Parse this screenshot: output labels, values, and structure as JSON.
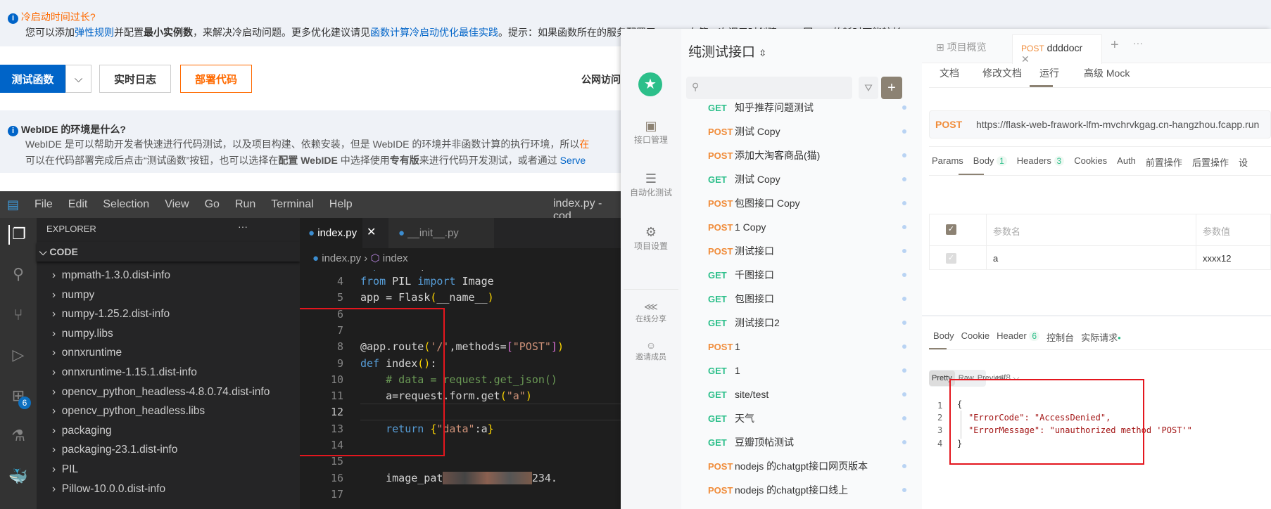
{
  "banner1": {
    "title": "冷启动时间过长?",
    "text_a": "您可以添加",
    "link_a": "弹性规则",
    "text_b": "并配置",
    "bold_b": "最小实例数",
    "text_c": "，来解决冷启动问题。更多优化建议请见",
    "link_c": "函数计算冷启动优化最佳实践",
    "text_d": "。提示：如果函数所在的服务配置了 VPC，在第一次调用时创建 VPC 网……的耗时可能较长"
  },
  "toolbar": {
    "test_label": "测试函数",
    "logs_label": "实时日志",
    "deploy_label": "部署代码",
    "public_label": "公网访问"
  },
  "banner2": {
    "title": "WebIDE 的环境是什么?",
    "line1": "WebIDE 是可以帮助开发者快速进行代码测试，以及项目构建、依赖安装，但是 WebIDE 的环境并非函数计算的执行环境，所以",
    "line1_tail": "在",
    "line2_a": "可以在代码部署完成后点击“测试函数”按钮，也可以选择在",
    "line2_bold1": "配置 WebIDE",
    "line2_b": " 中选择使用",
    "line2_bold2": "专有版",
    "line2_c": "来进行代码开发测试，或者通过 ",
    "line2_link": "Serve"
  },
  "vscode": {
    "menu": [
      "File",
      "Edit",
      "Selection",
      "View",
      "Go",
      "Run",
      "Terminal",
      "Help"
    ],
    "window_title": "index.py - cod",
    "explorer_title": "EXPLORER",
    "folder": "CODE",
    "ext_badge": "6",
    "tree": [
      "mpmath-1.3.0.dist-info",
      "numpy",
      "numpy-1.25.2.dist-info",
      "numpy.libs",
      "onnxruntime",
      "onnxruntime-1.15.1.dist-info",
      "opencv_python_headless-4.8.0.74.dist-info",
      "opencv_python_headless.libs",
      "packaging",
      "packaging-23.1.dist-info",
      "PIL",
      "Pillow-10.0.0.dist-info"
    ],
    "tabs": [
      {
        "label": "index.py",
        "active": true
      },
      {
        "label": "__init__.py",
        "active": false
      }
    ],
    "breadcrumb": [
      "index.py",
      "index"
    ]
  },
  "apifox": {
    "project": "纯测试接口",
    "side": [
      "接口管理",
      "自动化测试",
      "项目设置",
      "在线分享",
      "邀请成员"
    ],
    "items": [
      {
        "m": "GET",
        "n": "知乎推荐问题测试"
      },
      {
        "m": "POST",
        "n": "测试 Copy"
      },
      {
        "m": "POST",
        "n": "添加大淘客商品(猫)"
      },
      {
        "m": "GET",
        "n": "测试 Copy"
      },
      {
        "m": "POST",
        "n": "包图接口 Copy"
      },
      {
        "m": "POST",
        "n": "1 Copy"
      },
      {
        "m": "POST",
        "n": "测试接口"
      },
      {
        "m": "GET",
        "n": "千图接口"
      },
      {
        "m": "GET",
        "n": "包图接口"
      },
      {
        "m": "GET",
        "n": "测试接口2"
      },
      {
        "m": "POST",
        "n": "1"
      },
      {
        "m": "GET",
        "n": "1"
      },
      {
        "m": "GET",
        "n": "site/test"
      },
      {
        "m": "GET",
        "n": "天气"
      },
      {
        "m": "GET",
        "n": "豆瓣顶帖测试"
      },
      {
        "m": "POST",
        "n": "nodejs 的chatgpt接口网页版本"
      },
      {
        "m": "POST",
        "n": "nodejs 的chatgpt接口线上"
      }
    ],
    "top_tabs": {
      "overview": "项目概览",
      "req_method": "POST",
      "req_name": "ddddocr"
    },
    "sub_tabs": [
      "文档",
      "修改文档",
      "运行",
      "高级 Mock"
    ],
    "method": "POST",
    "url": "https://flask-web-frawork-lfm-mvchrvkgag.cn-hangzhou.fcapp.run",
    "param_tabs": [
      {
        "l": "Params"
      },
      {
        "l": "Body",
        "b": "1"
      },
      {
        "l": "Headers",
        "b": "3"
      },
      {
        "l": "Cookies"
      },
      {
        "l": "Auth"
      },
      {
        "l": "前置操作"
      },
      {
        "l": "后置操作"
      },
      {
        "l": "设"
      }
    ],
    "table": {
      "h1": "参数名",
      "h2": "参数值",
      "rows": [
        {
          "k": "a",
          "v": "xxxx12"
        }
      ]
    },
    "resp_tabs": [
      {
        "l": "Body"
      },
      {
        "l": "Cookie"
      },
      {
        "l": "Header",
        "b": "6"
      },
      {
        "l": "控制台"
      },
      {
        "l": "实际请求"
      }
    ],
    "views": [
      "Pretty",
      "Raw",
      "Preview"
    ],
    "encoding": "utf8",
    "json_lines": [
      "{",
      "\"ErrorCode\": \"AccessDenied\",",
      "\"ErrorMessage\": \"unauthorized method 'POST'\"",
      "}"
    ]
  },
  "colors": {
    "accent": "#0064c8",
    "deploy": "#ff6a00",
    "post": "#f08c3a",
    "get": "#2cbf8a",
    "highlight_box": "#e4161e"
  }
}
